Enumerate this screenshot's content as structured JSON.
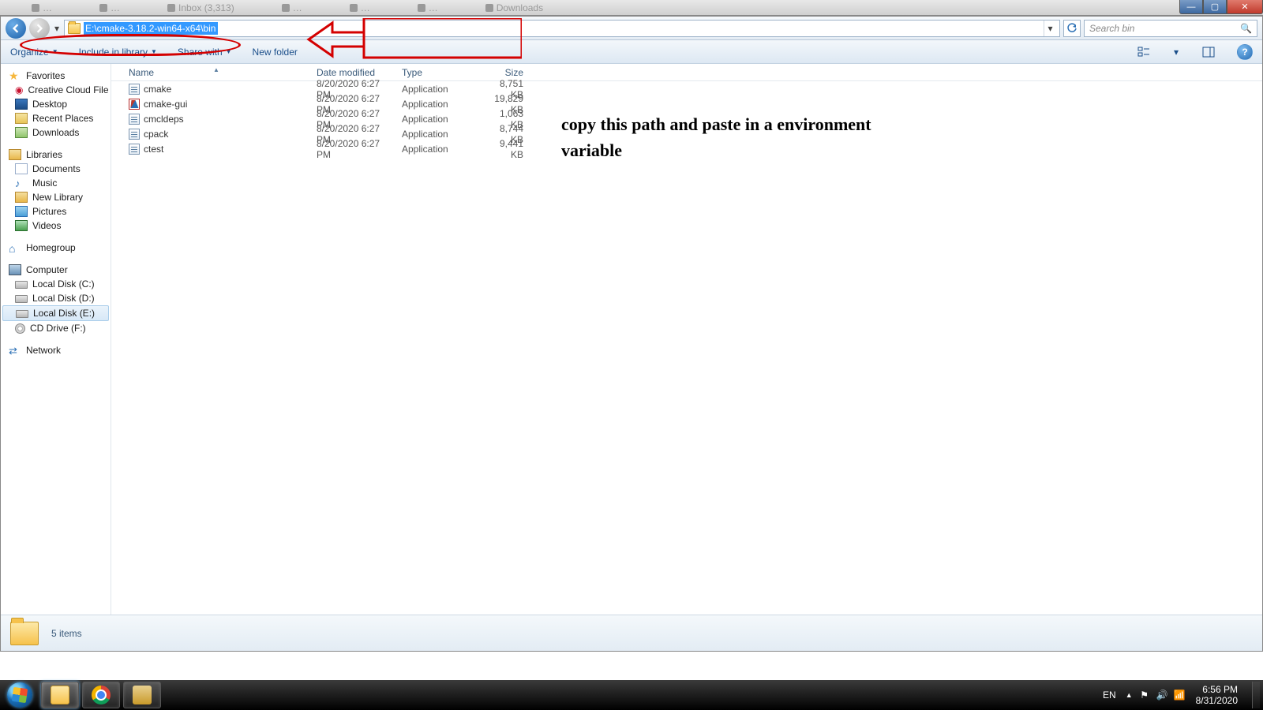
{
  "address_path": "E:\\cmake-3.18.2-win64-x64\\bin",
  "search_placeholder": "Search bin",
  "toolbar": {
    "organize": "Organize",
    "include": "Include in library",
    "share": "Share with",
    "newfolder": "New folder"
  },
  "columns": {
    "name": "Name",
    "date": "Date modified",
    "type": "Type",
    "size": "Size"
  },
  "nav": {
    "favorites": "Favorites",
    "creative_cloud": "Creative Cloud File",
    "desktop": "Desktop",
    "recent": "Recent Places",
    "downloads": "Downloads",
    "libraries": "Libraries",
    "documents": "Documents",
    "music": "Music",
    "newlibrary": "New Library",
    "pictures": "Pictures",
    "videos": "Videos",
    "homegroup": "Homegroup",
    "computer": "Computer",
    "drive_c": "Local Disk (C:)",
    "drive_d": "Local Disk (D:)",
    "drive_e": "Local Disk (E:)",
    "drive_cd": "CD Drive (F:)",
    "network": "Network"
  },
  "files": [
    {
      "name": "cmake",
      "date": "8/20/2020 6:27 PM",
      "type": "Application",
      "size": "8,751 KB",
      "ico": "exe"
    },
    {
      "name": "cmake-gui",
      "date": "8/20/2020 6:27 PM",
      "type": "Application",
      "size": "19,829 KB",
      "ico": "cmk"
    },
    {
      "name": "cmcldeps",
      "date": "8/20/2020 6:27 PM",
      "type": "Application",
      "size": "1,063 KB",
      "ico": "exe"
    },
    {
      "name": "cpack",
      "date": "8/20/2020 6:27 PM",
      "type": "Application",
      "size": "8,744 KB",
      "ico": "exe"
    },
    {
      "name": "ctest",
      "date": "8/20/2020 6:27 PM",
      "type": "Application",
      "size": "9,441 KB",
      "ico": "exe"
    }
  ],
  "status_items": "5 items",
  "annotation_text": "copy this path and paste in a environment variable",
  "tray": {
    "lang": "EN",
    "time": "6:56 PM",
    "date": "8/31/2020"
  }
}
